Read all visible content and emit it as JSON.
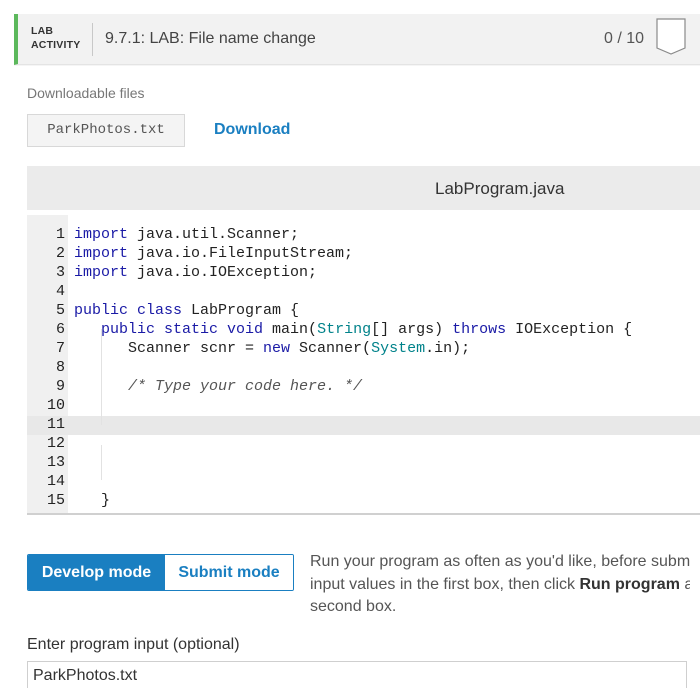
{
  "header": {
    "tag_line1": "LAB",
    "tag_line2": "ACTIVITY",
    "title": "9.7.1: LAB: File name change",
    "score": "0 / 10",
    "accent_color": "#5cb85c",
    "badge_icon": "score-badge-icon"
  },
  "downloads": {
    "label": "Downloadable files",
    "file_name": "ParkPhotos.txt",
    "download_label": "Download"
  },
  "editor": {
    "filename": "LabProgram.java",
    "active_line": 11,
    "lines": [
      {
        "n": "1",
        "parts": [
          {
            "t": "import",
            "c": "kw"
          },
          {
            "t": " java.util.Scanner;",
            "c": ""
          }
        ]
      },
      {
        "n": "2",
        "parts": [
          {
            "t": "import",
            "c": "kw"
          },
          {
            "t": " java.io.FileInputStream;",
            "c": ""
          }
        ]
      },
      {
        "n": "3",
        "parts": [
          {
            "t": "import",
            "c": "kw"
          },
          {
            "t": " java.io.IOException;",
            "c": ""
          }
        ]
      },
      {
        "n": "4",
        "parts": []
      },
      {
        "n": "5",
        "parts": [
          {
            "t": "public class",
            "c": "kw"
          },
          {
            "t": " LabProgram {",
            "c": ""
          }
        ]
      },
      {
        "n": "6",
        "parts": [
          {
            "t": "   ",
            "c": ""
          },
          {
            "t": "public static void",
            "c": "kw"
          },
          {
            "t": " main(",
            "c": ""
          },
          {
            "t": "String",
            "c": "ty"
          },
          {
            "t": "[] args) ",
            "c": ""
          },
          {
            "t": "throws",
            "c": "kw"
          },
          {
            "t": " IOException {",
            "c": ""
          }
        ]
      },
      {
        "n": "7",
        "parts": [
          {
            "t": "      Scanner scnr = ",
            "c": ""
          },
          {
            "t": "new",
            "c": "kw"
          },
          {
            "t": " Scanner(",
            "c": ""
          },
          {
            "t": "System",
            "c": "ty"
          },
          {
            "t": ".in);",
            "c": ""
          }
        ]
      },
      {
        "n": "8",
        "parts": []
      },
      {
        "n": "9",
        "parts": [
          {
            "t": "      ",
            "c": ""
          },
          {
            "t": "/* Type your code here. */",
            "c": "cm"
          }
        ]
      },
      {
        "n": "10",
        "parts": []
      },
      {
        "n": "11",
        "parts": []
      },
      {
        "n": "12",
        "parts": []
      },
      {
        "n": "13",
        "parts": []
      },
      {
        "n": "14",
        "parts": []
      },
      {
        "n": "15",
        "parts": [
          {
            "t": "   }",
            "c": ""
          }
        ]
      }
    ]
  },
  "modes": {
    "develop_label": "Develop mode",
    "submit_label": "Submit mode",
    "active": "develop"
  },
  "instructions": {
    "line1": "Run your program as often as you'd like, before submi",
    "line2_pre": "input values in the first box, then click ",
    "line2_bold": "Run program",
    "line2_post": " a",
    "line3": "second box."
  },
  "input": {
    "label": "Enter program input (optional)",
    "value": "ParkPhotos.txt"
  }
}
